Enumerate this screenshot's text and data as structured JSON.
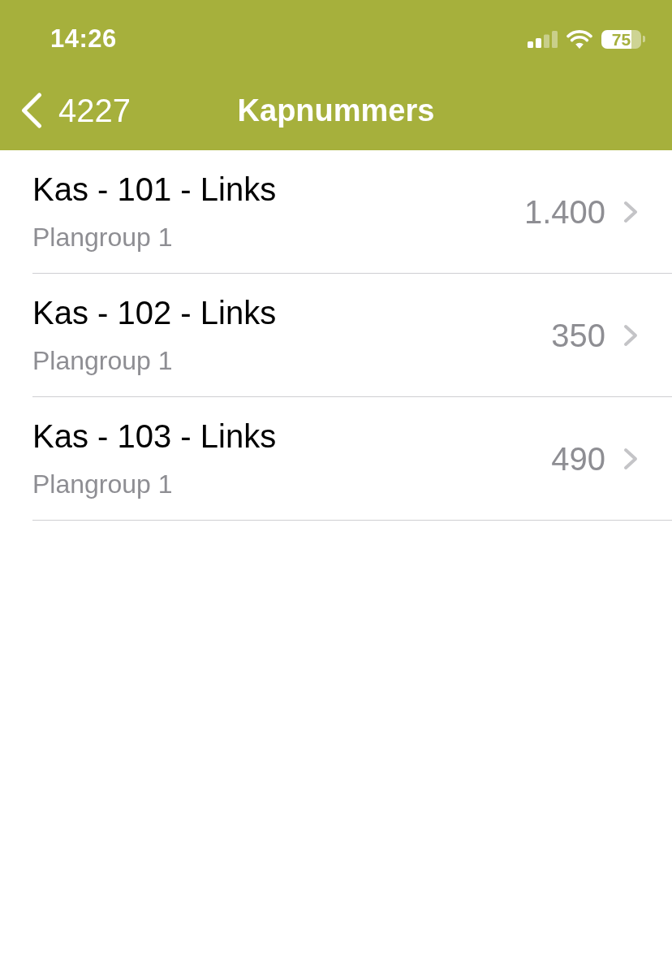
{
  "status_bar": {
    "time": "14:26",
    "battery": "75"
  },
  "nav_bar": {
    "back_label": "4227",
    "title": "Kapnummers"
  },
  "list": {
    "items": [
      {
        "title": "Kas - 101 - Links",
        "subtitle": "Plangroup 1",
        "value": "1.400"
      },
      {
        "title": "Kas - 102 - Links",
        "subtitle": "Plangroup 1",
        "value": "350"
      },
      {
        "title": "Kas - 103 - Links",
        "subtitle": "Plangroup 1",
        "value": "490"
      }
    ]
  }
}
